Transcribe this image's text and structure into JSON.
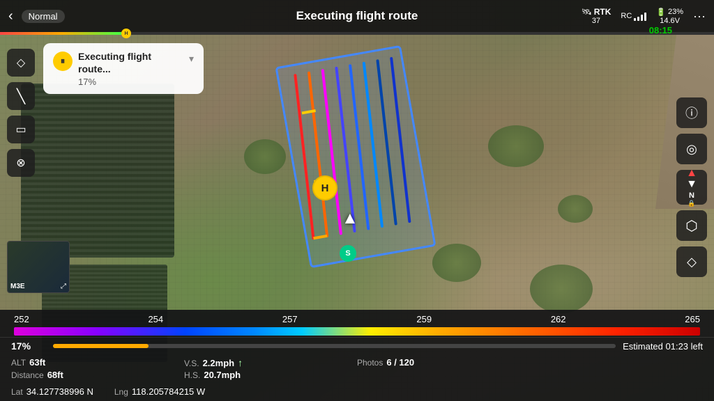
{
  "header": {
    "back_label": "‹",
    "mode": "Normal",
    "title": "Executing flight route",
    "rtk_label": "RTK",
    "rtk_value": "37",
    "rtk_icon": "satellite-icon",
    "rc_label": "RC",
    "battery_pct": "23%",
    "battery_voltage": "14.6V",
    "more_label": "···"
  },
  "progress_track": {
    "time_label": "08:15",
    "home_label": "H"
  },
  "task_card": {
    "pause_icon": "pause-icon",
    "task_title": "Executing flight route...",
    "task_percent": "17%",
    "chevron": "▾"
  },
  "left_toolbar": {
    "items": [
      {
        "icon": "diamond-icon",
        "symbol": "◇"
      },
      {
        "icon": "line-icon",
        "symbol": "╲"
      },
      {
        "icon": "rectangle-icon",
        "symbol": "▭"
      },
      {
        "icon": "close-icon",
        "symbol": "⊗"
      }
    ]
  },
  "right_toolbar": {
    "items": [
      {
        "icon": "info-icon",
        "symbol": "ⓘ"
      },
      {
        "icon": "target-icon",
        "symbol": "◎"
      },
      {
        "icon": "north-label",
        "symbol": "N"
      },
      {
        "icon": "layers-icon",
        "symbol": "⬡"
      },
      {
        "icon": "diamond-icon2",
        "symbol": "◇"
      }
    ]
  },
  "markers": {
    "home": "H",
    "start": "S"
  },
  "scale_bar": {
    "labels": [
      "252",
      "254",
      "257",
      "259",
      "262",
      "265"
    ]
  },
  "stats": {
    "progress_pct": "17%",
    "estimated_label": "Estimated 01:23 left",
    "alt_label": "ALT",
    "alt_value": "63ft",
    "vs_label": "V.S.",
    "vs_value": "2.2mph",
    "dist_label": "Distance",
    "dist_value": "68ft",
    "hs_label": "H.S.",
    "hs_value": "20.7mph",
    "photos_label": "Photos",
    "photos_value": "6 / 120"
  },
  "coords": {
    "lat_label": "Lat",
    "lat_value": "34.127738996 N",
    "lng_label": "Lng",
    "lng_value": "118.205784215 W"
  },
  "mini_view": {
    "label": "M3E"
  }
}
